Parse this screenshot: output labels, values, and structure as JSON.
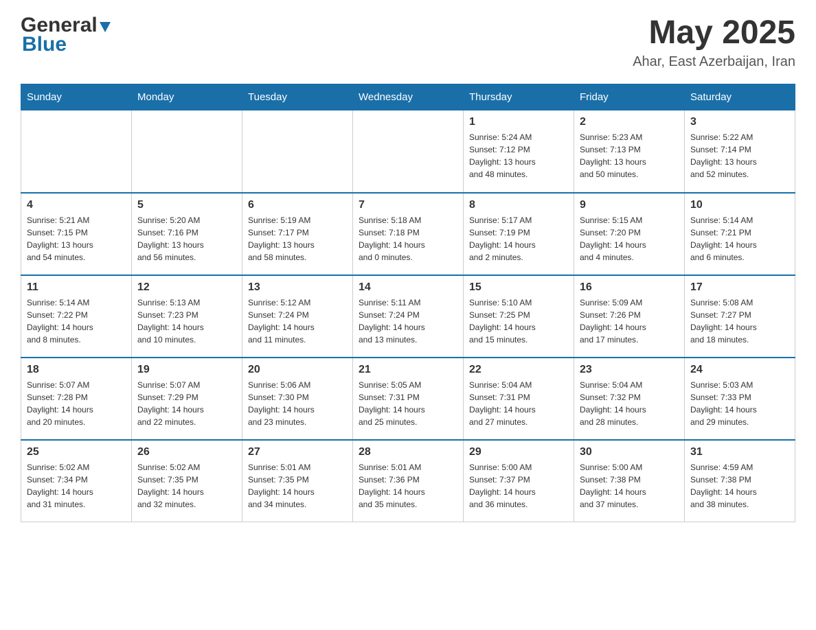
{
  "header": {
    "logo_text_black": "General",
    "logo_text_blue": "Blue",
    "month_year": "May 2025",
    "location": "Ahar, East Azerbaijan, Iran"
  },
  "weekdays": [
    "Sunday",
    "Monday",
    "Tuesday",
    "Wednesday",
    "Thursday",
    "Friday",
    "Saturday"
  ],
  "weeks": [
    [
      {
        "day": "",
        "info": ""
      },
      {
        "day": "",
        "info": ""
      },
      {
        "day": "",
        "info": ""
      },
      {
        "day": "",
        "info": ""
      },
      {
        "day": "1",
        "info": "Sunrise: 5:24 AM\nSunset: 7:12 PM\nDaylight: 13 hours\nand 48 minutes."
      },
      {
        "day": "2",
        "info": "Sunrise: 5:23 AM\nSunset: 7:13 PM\nDaylight: 13 hours\nand 50 minutes."
      },
      {
        "day": "3",
        "info": "Sunrise: 5:22 AM\nSunset: 7:14 PM\nDaylight: 13 hours\nand 52 minutes."
      }
    ],
    [
      {
        "day": "4",
        "info": "Sunrise: 5:21 AM\nSunset: 7:15 PM\nDaylight: 13 hours\nand 54 minutes."
      },
      {
        "day": "5",
        "info": "Sunrise: 5:20 AM\nSunset: 7:16 PM\nDaylight: 13 hours\nand 56 minutes."
      },
      {
        "day": "6",
        "info": "Sunrise: 5:19 AM\nSunset: 7:17 PM\nDaylight: 13 hours\nand 58 minutes."
      },
      {
        "day": "7",
        "info": "Sunrise: 5:18 AM\nSunset: 7:18 PM\nDaylight: 14 hours\nand 0 minutes."
      },
      {
        "day": "8",
        "info": "Sunrise: 5:17 AM\nSunset: 7:19 PM\nDaylight: 14 hours\nand 2 minutes."
      },
      {
        "day": "9",
        "info": "Sunrise: 5:15 AM\nSunset: 7:20 PM\nDaylight: 14 hours\nand 4 minutes."
      },
      {
        "day": "10",
        "info": "Sunrise: 5:14 AM\nSunset: 7:21 PM\nDaylight: 14 hours\nand 6 minutes."
      }
    ],
    [
      {
        "day": "11",
        "info": "Sunrise: 5:14 AM\nSunset: 7:22 PM\nDaylight: 14 hours\nand 8 minutes."
      },
      {
        "day": "12",
        "info": "Sunrise: 5:13 AM\nSunset: 7:23 PM\nDaylight: 14 hours\nand 10 minutes."
      },
      {
        "day": "13",
        "info": "Sunrise: 5:12 AM\nSunset: 7:24 PM\nDaylight: 14 hours\nand 11 minutes."
      },
      {
        "day": "14",
        "info": "Sunrise: 5:11 AM\nSunset: 7:24 PM\nDaylight: 14 hours\nand 13 minutes."
      },
      {
        "day": "15",
        "info": "Sunrise: 5:10 AM\nSunset: 7:25 PM\nDaylight: 14 hours\nand 15 minutes."
      },
      {
        "day": "16",
        "info": "Sunrise: 5:09 AM\nSunset: 7:26 PM\nDaylight: 14 hours\nand 17 minutes."
      },
      {
        "day": "17",
        "info": "Sunrise: 5:08 AM\nSunset: 7:27 PM\nDaylight: 14 hours\nand 18 minutes."
      }
    ],
    [
      {
        "day": "18",
        "info": "Sunrise: 5:07 AM\nSunset: 7:28 PM\nDaylight: 14 hours\nand 20 minutes."
      },
      {
        "day": "19",
        "info": "Sunrise: 5:07 AM\nSunset: 7:29 PM\nDaylight: 14 hours\nand 22 minutes."
      },
      {
        "day": "20",
        "info": "Sunrise: 5:06 AM\nSunset: 7:30 PM\nDaylight: 14 hours\nand 23 minutes."
      },
      {
        "day": "21",
        "info": "Sunrise: 5:05 AM\nSunset: 7:31 PM\nDaylight: 14 hours\nand 25 minutes."
      },
      {
        "day": "22",
        "info": "Sunrise: 5:04 AM\nSunset: 7:31 PM\nDaylight: 14 hours\nand 27 minutes."
      },
      {
        "day": "23",
        "info": "Sunrise: 5:04 AM\nSunset: 7:32 PM\nDaylight: 14 hours\nand 28 minutes."
      },
      {
        "day": "24",
        "info": "Sunrise: 5:03 AM\nSunset: 7:33 PM\nDaylight: 14 hours\nand 29 minutes."
      }
    ],
    [
      {
        "day": "25",
        "info": "Sunrise: 5:02 AM\nSunset: 7:34 PM\nDaylight: 14 hours\nand 31 minutes."
      },
      {
        "day": "26",
        "info": "Sunrise: 5:02 AM\nSunset: 7:35 PM\nDaylight: 14 hours\nand 32 minutes."
      },
      {
        "day": "27",
        "info": "Sunrise: 5:01 AM\nSunset: 7:35 PM\nDaylight: 14 hours\nand 34 minutes."
      },
      {
        "day": "28",
        "info": "Sunrise: 5:01 AM\nSunset: 7:36 PM\nDaylight: 14 hours\nand 35 minutes."
      },
      {
        "day": "29",
        "info": "Sunrise: 5:00 AM\nSunset: 7:37 PM\nDaylight: 14 hours\nand 36 minutes."
      },
      {
        "day": "30",
        "info": "Sunrise: 5:00 AM\nSunset: 7:38 PM\nDaylight: 14 hours\nand 37 minutes."
      },
      {
        "day": "31",
        "info": "Sunrise: 4:59 AM\nSunset: 7:38 PM\nDaylight: 14 hours\nand 38 minutes."
      }
    ]
  ]
}
